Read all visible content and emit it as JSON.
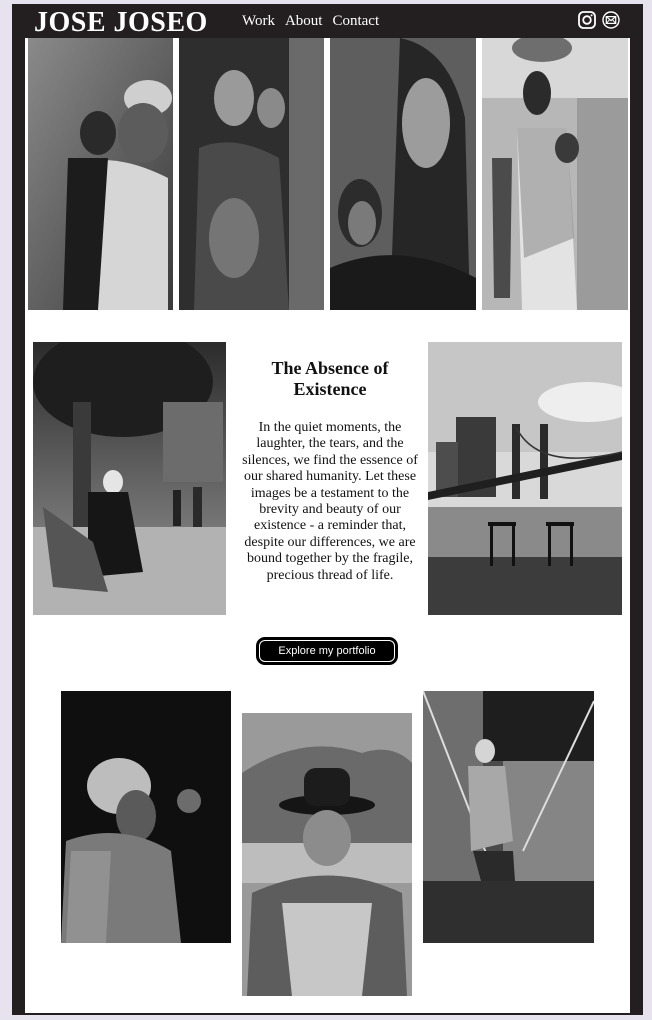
{
  "header": {
    "brand": "JOSE JOSEO",
    "nav": [
      {
        "label": "Work"
      },
      {
        "label": "About"
      },
      {
        "label": "Contact"
      }
    ],
    "social_icons": [
      "instagram-icon",
      "mail-icon"
    ]
  },
  "intro": {
    "title": "The Absence of Existence",
    "body": "In the quiet moments, the laughter, the tears, and the silences, we find the essence of our shared humanity. Let these images be a testament to the brevity and beauty of our existence - a reminder that, despite our differences, we are bound together by the fragile, precious thread of life.",
    "cta_label": "Explore my portfolio"
  },
  "colors": {
    "navbar": "#231f20",
    "page": "#ffffff",
    "cta": "#000000"
  }
}
